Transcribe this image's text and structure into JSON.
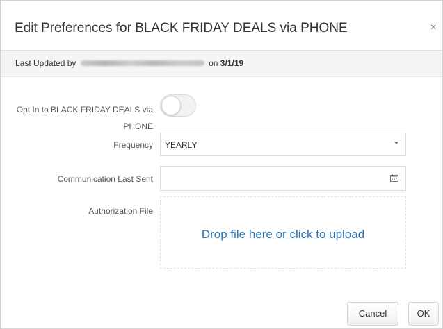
{
  "dialog": {
    "title": "Edit Preferences for BLACK FRIDAY DEALS via PHONE",
    "close_icon": "×"
  },
  "last_updated": {
    "prefix": "Last Updated by",
    "on_word": "on",
    "date": "3/1/19"
  },
  "form": {
    "opt_in": {
      "label": "Opt In to BLACK FRIDAY DEALS via PHONE",
      "checked": false
    },
    "frequency": {
      "label": "Frequency",
      "value": "YEARLY"
    },
    "communication_last_sent": {
      "label": "Communication Last Sent",
      "value": ""
    },
    "authorization_file": {
      "label": "Authorization File",
      "dropzone_text": "Drop file here or click to upload"
    }
  },
  "footer": {
    "cancel_label": "Cancel",
    "ok_label": "OK"
  },
  "colors": {
    "link": "#2a75b3",
    "header_bar": "#f5f5f5"
  }
}
